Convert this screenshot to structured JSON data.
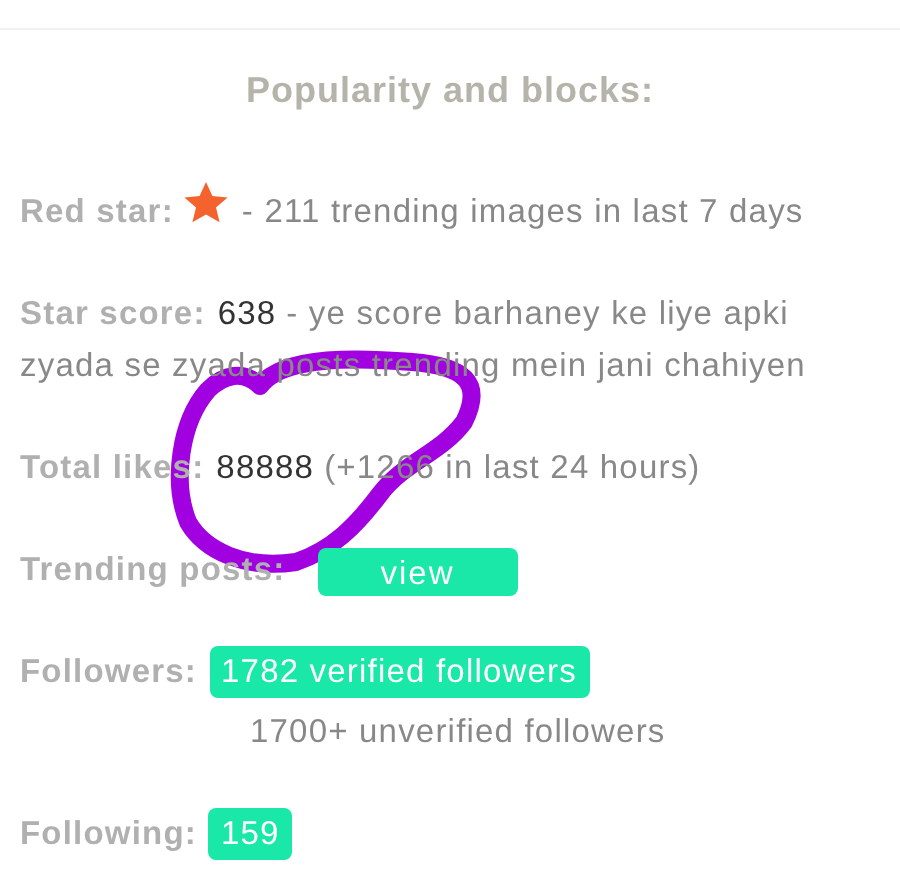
{
  "title": "Popularity and blocks:",
  "rows": [
    {
      "kind": "star",
      "label": "Red star:",
      "description": "- 211 trending images in last 7 days"
    },
    {
      "kind": "value",
      "label": "Star score:",
      "value": "638",
      "description": "- ye score barhaney ke liye apki zyada se zyada posts trending mein jani chahiyen"
    },
    {
      "kind": "value",
      "label": "Total likes:",
      "value": "88888",
      "description": "(+1266 in last 24 hours)"
    },
    {
      "kind": "button",
      "label": "Trending posts:",
      "button": "view"
    },
    {
      "kind": "badge",
      "label": "Followers:",
      "badge": "1782 verified followers",
      "note": "1700+ unverified followers"
    },
    {
      "kind": "badge",
      "label": "Following:",
      "badge": "159"
    }
  ],
  "annotation": {
    "kind": "circle"
  }
}
